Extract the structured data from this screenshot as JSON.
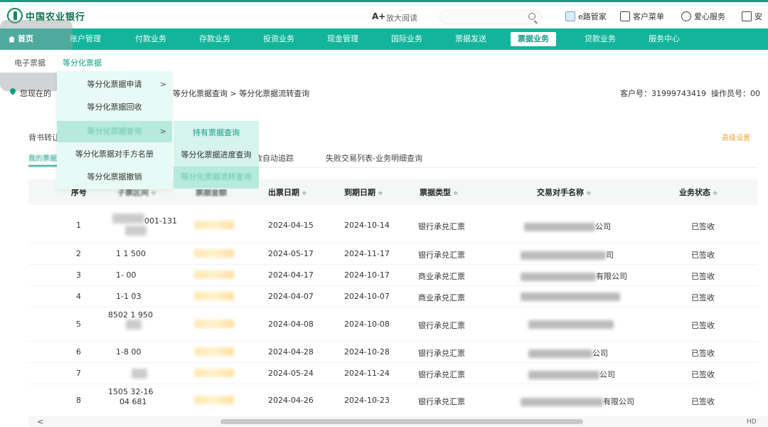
{
  "header": {
    "bank_name": "中国农业银行",
    "font_size_label": "A+",
    "font_size_text": "放大阅读",
    "links": [
      {
        "label": "e路管家",
        "icon": "monitor-icon"
      },
      {
        "label": "客户菜单",
        "icon": "menu-icon"
      },
      {
        "label": "爱心服务",
        "icon": "person-icon"
      },
      {
        "label": "安",
        "icon": "logout-icon"
      }
    ]
  },
  "nav": {
    "home": "首页",
    "items": [
      "账户管理",
      "付款业务",
      "存款业务",
      "投资业务",
      "现金管理",
      "国际业务",
      "票据发送",
      "票据业务",
      "贷款业务",
      "服务中心"
    ],
    "active_index": 7
  },
  "subnav": {
    "items": [
      "电子票据",
      "等分化票据"
    ],
    "active_index": 1
  },
  "breadcrumb": {
    "location_label": "您现在的",
    "path": "等分化票据查询 > 等分化票据流转查询"
  },
  "customer": {
    "customer_no_label": "客户号：",
    "customer_no": "31999743419",
    "operator_label": "操作员号：",
    "operator_no": "00"
  },
  "menu1": {
    "items": [
      {
        "label": "等分化票据申请",
        "has_sub": true
      },
      {
        "label": "等分化票据回收",
        "has_sub": false
      },
      {
        "label": "等分化票据查询",
        "has_sub": true,
        "highlighted": true
      },
      {
        "label": "等分化票据对手方名册",
        "has_sub": false
      },
      {
        "label": "等分化票据撤销",
        "has_sub": false
      }
    ],
    "arrow": ">"
  },
  "menu2": {
    "items": [
      {
        "label": "持有票据查询"
      },
      {
        "label": "等分化票据进度查询"
      },
      {
        "label": "等分化票据流转查询",
        "highlighted": true
      }
    ]
  },
  "filter": {
    "label": "背书转让",
    "right_link": "高级设置"
  },
  "tabs": {
    "first": "我的票据",
    "items": [
      "已签收自动追踪",
      "失败交易列表-业务明细查询"
    ]
  },
  "table": {
    "sort_glyph": "≑",
    "headers": [
      "序号",
      "子票区间",
      "票据金额",
      "出票日期",
      "到期日期",
      "票据类型",
      "交易对手名称",
      "业务状态"
    ],
    "rows": [
      {
        "no": "1",
        "range": [
          "001-131",
          ""
        ],
        "issue": "2024-04-15",
        "due": "2024-10-14",
        "type": "银行承兑汇票",
        "cp_suffix": "公司",
        "status": "已签收"
      },
      {
        "no": "2",
        "range": [
          "1 1 500"
        ],
        "issue": "2024-05-17",
        "due": "2024-11-17",
        "type": "银行承兑汇票",
        "cp_suffix": "司",
        "status": "已签收"
      },
      {
        "no": "3",
        "range": [
          "1- 00"
        ],
        "issue": "2024-04-17",
        "due": "2024-10-17",
        "type": "商业承兑汇票",
        "cp_suffix": "有限公司",
        "status": "已签收"
      },
      {
        "no": "4",
        "range": [
          "1-1 03"
        ],
        "issue": "2024-04-07",
        "due": "2024-10-07",
        "type": "商业承兑汇票",
        "cp_suffix": "",
        "status": "已签收"
      },
      {
        "no": "5",
        "range": [
          "8502 1 950",
          ""
        ],
        "issue": "2024-04-08",
        "due": "2024-10-08",
        "type": "银行承兑汇票",
        "cp_suffix": "",
        "status": "已签收"
      },
      {
        "no": "6",
        "range": [
          "1-8 00"
        ],
        "issue": "2024-04-28",
        "due": "2024-10-28",
        "type": "银行承兑汇票",
        "cp_suffix": "公司",
        "status": "已签收"
      },
      {
        "no": "7",
        "range": [
          ""
        ],
        "issue": "2024-05-24",
        "due": "2024-11-24",
        "type": "银行承兑汇票",
        "cp_suffix": "公司",
        "status": "已签收"
      },
      {
        "no": "8",
        "range": [
          "1505 32-16",
          "04 681"
        ],
        "issue": "2024-04-26",
        "due": "2024-10-23",
        "type": "银行承兑汇票",
        "cp_suffix": "有限公司",
        "status": "已签收"
      }
    ]
  },
  "scrollbar": {
    "left_arrow": "<",
    "corner": "HD"
  }
}
